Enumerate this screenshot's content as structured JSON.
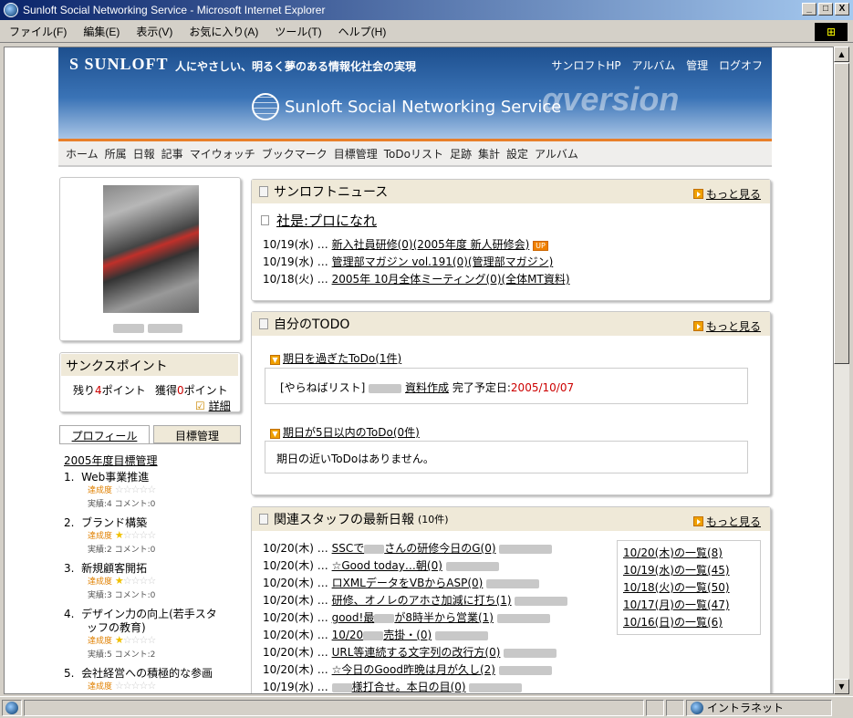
{
  "window": {
    "title": "Sunloft Social Networking Service - Microsoft Internet Explorer",
    "btn_min": "_",
    "btn_max": "□",
    "btn_close": "X"
  },
  "menu": [
    "ファイル(F)",
    "編集(E)",
    "表示(V)",
    "お気に入り(A)",
    "ツール(T)",
    "ヘルプ(H)"
  ],
  "status": {
    "zone": "イントラネット"
  },
  "header": {
    "logo": "S SUNLOFT",
    "slogan": "人にやさしい、明るく夢のある情報化社会の実現",
    "links": [
      "サンロフトHP",
      "アルバム",
      "管理",
      "ログオフ"
    ],
    "service": "Sunloft Social Networking Service",
    "version": "αversion"
  },
  "nav": [
    "ホーム",
    "所属",
    "日報",
    "記事",
    "マイウォッチ",
    "ブックマーク",
    "目標管理",
    "ToDoリスト",
    "足跡",
    "集計",
    "設定",
    "アルバム"
  ],
  "thanks": {
    "title": "サンクスポイント",
    "remain_pre": "残り",
    "remain_num": "4",
    "remain_post": "ポイント",
    "earn_pre": "獲得",
    "earn_num": "0",
    "earn_post": "ポイント",
    "detail": "詳細"
  },
  "tabs": {
    "profile": "プロフィール",
    "goals": "目標管理"
  },
  "goals": {
    "title": "2005年度目標管理",
    "rate_label": "達成度",
    "items": [
      {
        "no": "1.",
        "name": "Web事業推進",
        "stars": 0,
        "stats": "実績:4 コメント:0"
      },
      {
        "no": "2.",
        "name": "ブランド構築",
        "stars": 1,
        "stats": "実績:2 コメント:0"
      },
      {
        "no": "3.",
        "name": "新規顧客開拓",
        "stars": 1,
        "stats": "実績:3 コメント:0"
      },
      {
        "no": "4.",
        "name": "デザイン力の向上(若手スタ",
        "name2": "ッフの教育)",
        "stars": 1,
        "stats": "実績:5 コメント:2"
      },
      {
        "no": "5.",
        "name": "会社経営への積極的な参画",
        "stars": 0,
        "stats": ""
      }
    ]
  },
  "news": {
    "title": "サンロフトニュース",
    "more": "もっと見る",
    "headline": "社是:プロになれ",
    "items": [
      {
        "date": "10/19(水) …",
        "link": "新入社員研修(0)",
        "cat": "(2005年度 新人研修会)",
        "up": "UP"
      },
      {
        "date": "10/19(水) …",
        "link": "管理部マガジン vol.191(0)",
        "cat": "(管理部マガジン)",
        "up": ""
      },
      {
        "date": "10/18(火) …",
        "link": "2005年 10月全体ミーティング(0)",
        "cat": "(全体MT資料)",
        "up": ""
      }
    ]
  },
  "todo": {
    "title": "自分のTODO",
    "more": "もっと見る",
    "overdue": "期日を過ぎたToDo(1件)",
    "overdue_item_pre": "[やらねばリスト]",
    "overdue_item_link": "資料作成",
    "overdue_item_due_label": "完了予定日:",
    "overdue_item_due": "2005/10/07",
    "soon": "期日が5日以内のToDo(0件)",
    "soon_none": "期日の近いToDoはありません。"
  },
  "reports": {
    "title": "関連スタッフの最新日報",
    "count": "(10件)",
    "more": "もっと見る",
    "items": [
      {
        "date": "10/20(木) …",
        "link": "SSCで",
        "link2": "さんの研修今日のG(0)"
      },
      {
        "date": "10/20(木) …",
        "link": "☆Good today…朝(0)",
        "link2": ""
      },
      {
        "date": "10/20(木) …",
        "link": "ロXMLデータをVBからASP(0)",
        "link2": ""
      },
      {
        "date": "10/20(木) …",
        "link": "研修、オノレのアホさ加減に打ち(1)",
        "link2": ""
      },
      {
        "date": "10/20(木) …",
        "link": "good!最",
        "link2": "が8時半から営業(1)"
      },
      {
        "date": "10/20(木) …",
        "link": "10/20",
        "link2": "売掛・(0)"
      },
      {
        "date": "10/20(木) …",
        "link": "URL等連続する文字列の改行方(0)",
        "link2": ""
      },
      {
        "date": "10/20(木) …",
        "link": "☆今日のGood昨晩は月が久し(2)",
        "link2": ""
      },
      {
        "date": "10/19(水) …",
        "link": "",
        "link2": "様打合せ。本日の目(0)"
      }
    ],
    "daylist": [
      "10/20(木)の一覧(8)",
      "10/19(水)の一覧(45)",
      "10/18(火)の一覧(50)",
      "10/17(月)の一覧(47)",
      "10/16(日)の一覧(6)"
    ]
  }
}
